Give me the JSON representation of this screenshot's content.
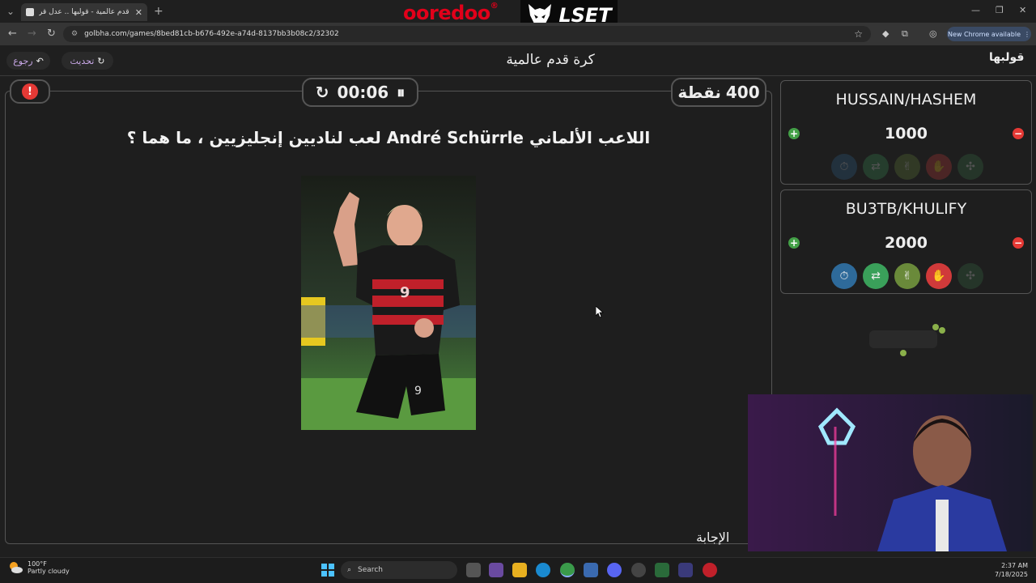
{
  "browser": {
    "tab_title": "كرة قدم عالمية - قولبها .. عدل قر...",
    "url": "golbha.com/games/8bed81cb-b676-492e-a74d-8137bb3b08c2/32302",
    "new_chrome_label": "New Chrome available",
    "sponsor_1": "ooredoo",
    "sponsor_2": "LSET"
  },
  "header": {
    "back_label": "رجوع",
    "refresh_label": "تحديث",
    "title": "كرة قدم عالمية",
    "logo_text": "قولبها"
  },
  "game": {
    "timer": "00:06",
    "points_value": "400",
    "points_label": "نقطة",
    "question": "اللاعب الألماني André Schürrle لعب لناديين إنجليزيين ، ما هما ؟",
    "answer_label": "الإجابة"
  },
  "teams": [
    {
      "name": "HUSSAIN/HASHEM",
      "score": "1000",
      "helps": [
        {
          "icon": "stopwatch-icon",
          "used": true
        },
        {
          "icon": "swap-icon",
          "used": true
        },
        {
          "icon": "two-fingers-icon",
          "used": true
        },
        {
          "icon": "hand-stop-icon",
          "used": true
        },
        {
          "icon": "pinwheel-icon",
          "used": true
        }
      ]
    },
    {
      "name": "BU3TB/KHULIFY",
      "score": "2000",
      "helps": [
        {
          "icon": "stopwatch-icon",
          "used": false
        },
        {
          "icon": "swap-icon",
          "used": false
        },
        {
          "icon": "two-fingers-icon",
          "used": false
        },
        {
          "icon": "hand-stop-icon",
          "used": false
        },
        {
          "icon": "pinwheel-icon",
          "used": true
        }
      ]
    }
  ],
  "taskbar": {
    "temperature": "100°F",
    "weather": "Partly cloudy",
    "search_label": "Search",
    "time": "2:37 AM",
    "date": "7/18/2025"
  },
  "colors": {
    "accent_purple": "#c9a8e8",
    "plus_green": "#43a047",
    "minus_red": "#e53935",
    "ooredoo_red": "#e2001a"
  }
}
